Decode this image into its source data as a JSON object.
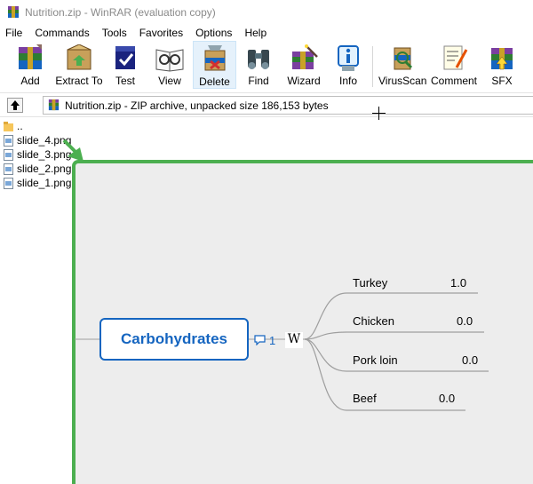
{
  "window": {
    "title": "Nutrition.zip - WinRAR (evaluation copy)"
  },
  "menu": [
    "File",
    "Commands",
    "Tools",
    "Favorites",
    "Options",
    "Help"
  ],
  "toolbar": {
    "buttons": [
      {
        "label": "Add",
        "icon": "add-archive-icon"
      },
      {
        "label": "Extract To",
        "icon": "extract-icon"
      },
      {
        "label": "Test",
        "icon": "test-icon"
      },
      {
        "label": "View",
        "icon": "view-icon"
      },
      {
        "label": "Delete",
        "icon": "delete-icon"
      },
      {
        "label": "Find",
        "icon": "find-binoculars-icon"
      },
      {
        "label": "Wizard",
        "icon": "wizard-icon"
      },
      {
        "label": "Info",
        "icon": "info-icon"
      },
      {
        "label": "VirusScan",
        "icon": "virus-scan-icon"
      },
      {
        "label": "Comment",
        "icon": "comment-icon"
      },
      {
        "label": "SFX",
        "icon": "sfx-icon"
      }
    ]
  },
  "address": {
    "path": "Nutrition.zip - ZIP archive, unpacked size 186,153 bytes"
  },
  "files": [
    "..",
    "slide_4.png",
    "slide_3.png",
    "slide_2.png",
    "slide_1.png"
  ],
  "mindmap": {
    "central": "Carbohydrates",
    "comment_count": "1",
    "w_badge": "W",
    "branches": [
      {
        "label": "Turkey",
        "value": "1.0"
      },
      {
        "label": "Chicken",
        "value": "0.0"
      },
      {
        "label": "Pork loin",
        "value": "0.0"
      },
      {
        "label": "Beef",
        "value": "0.0"
      }
    ]
  },
  "colors": {
    "callout_border": "#4caf50",
    "topic_blue": "#1565c0",
    "callout_bg": "#ededed"
  }
}
